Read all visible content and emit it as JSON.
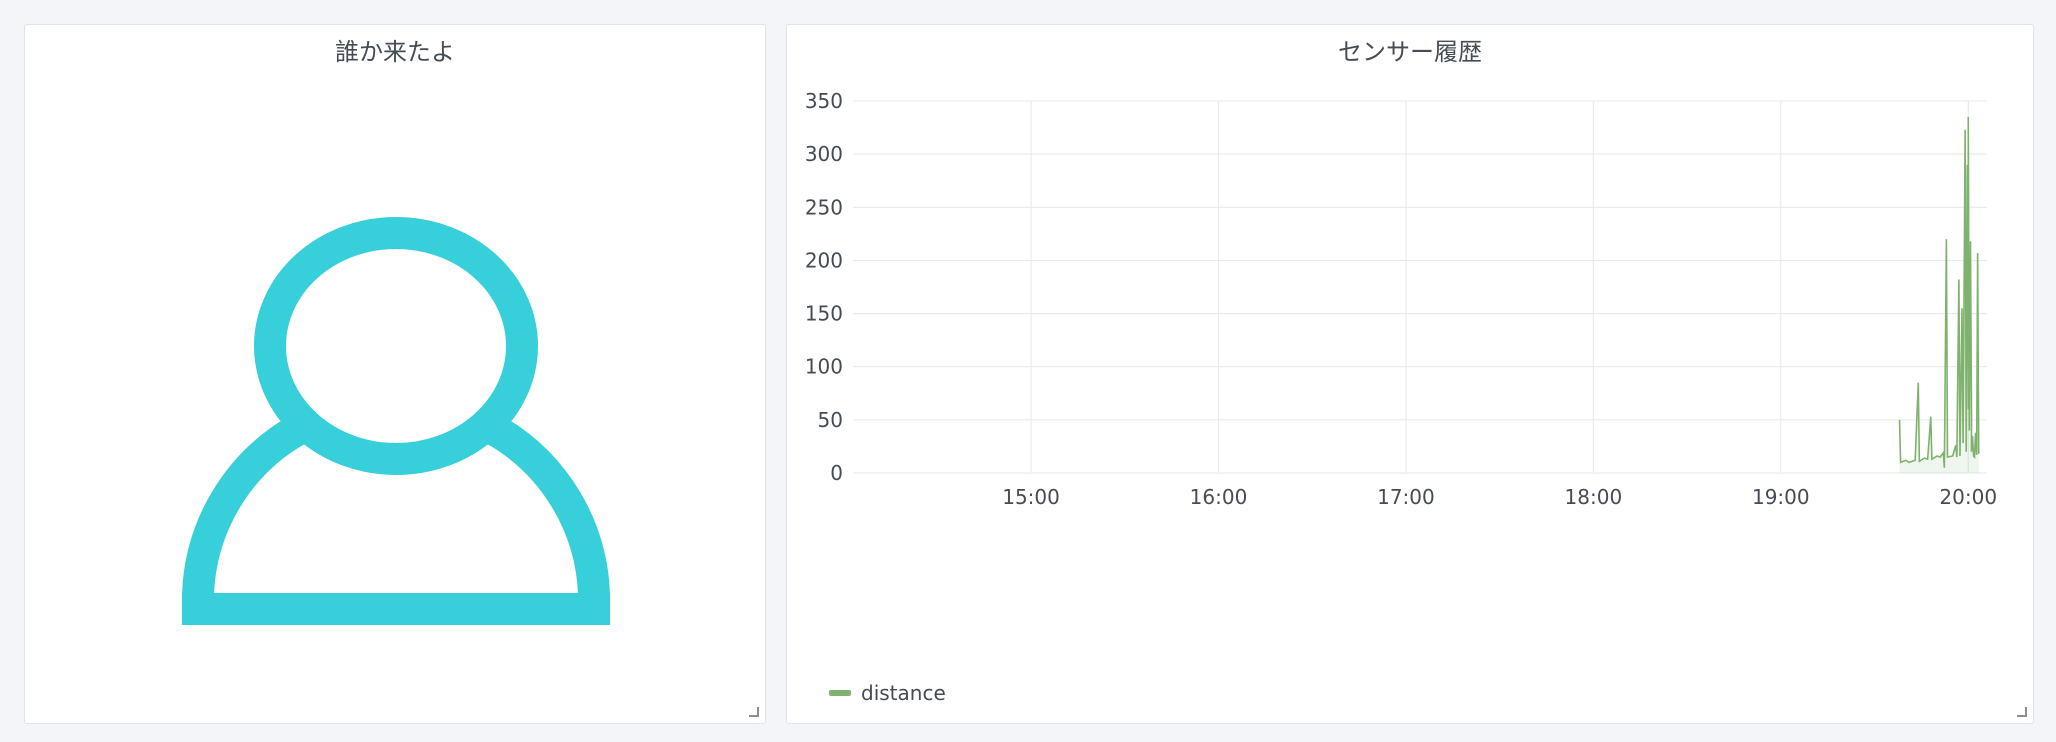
{
  "panels": {
    "left": {
      "title": "誰か来たよ",
      "icon": "person-icon",
      "icon_color": "#37cfd9"
    },
    "right": {
      "title": "センサー履歴"
    }
  },
  "chart_data": {
    "type": "line",
    "x_axis": "time",
    "x_ticks": [
      "15:00",
      "16:00",
      "17:00",
      "18:00",
      "19:00",
      "20:00"
    ],
    "xlim": [
      "14:03",
      "20:06"
    ],
    "ylim": [
      0,
      350
    ],
    "y_ticks": [
      0,
      50,
      100,
      150,
      200,
      250,
      300,
      350
    ],
    "grid": true,
    "legend_position": "bottom-left",
    "series": [
      {
        "name": "distance",
        "color": "#7eb26d",
        "points": [
          [
            "19:38",
            50
          ],
          [
            "19:38",
            10
          ],
          [
            "19:40",
            12
          ],
          [
            "19:41",
            10
          ],
          [
            "19:43",
            12
          ],
          [
            "19:44",
            85
          ],
          [
            "19:44",
            11
          ],
          [
            "19:46",
            14
          ],
          [
            "19:47",
            13
          ],
          [
            "19:48",
            53
          ],
          [
            "19:48",
            13
          ],
          [
            "19:50",
            16
          ],
          [
            "19:51",
            15
          ],
          [
            "19:52",
            19
          ],
          [
            "19:52",
            5
          ],
          [
            "19:53",
            220
          ],
          [
            "19:53",
            15
          ],
          [
            "19:55",
            16
          ],
          [
            "19:56",
            26
          ],
          [
            "19:56",
            15
          ],
          [
            "19:57",
            182
          ],
          [
            "19:57",
            16
          ],
          [
            "19:58",
            155
          ],
          [
            "19:58",
            28
          ],
          [
            "19:59",
            323
          ],
          [
            "19:59",
            20
          ],
          [
            "19:59",
            290
          ],
          [
            "19:59",
            60
          ],
          [
            "20:00",
            335
          ],
          [
            "20:00",
            40
          ],
          [
            "20:00",
            218
          ],
          [
            "20:00",
            50
          ],
          [
            "20:01",
            20
          ],
          [
            "20:01",
            35
          ],
          [
            "20:01",
            16
          ],
          [
            "20:02",
            15
          ],
          [
            "20:02",
            38
          ],
          [
            "20:02",
            17
          ],
          [
            "20:03",
            207
          ],
          [
            "20:03",
            18
          ]
        ]
      }
    ]
  }
}
